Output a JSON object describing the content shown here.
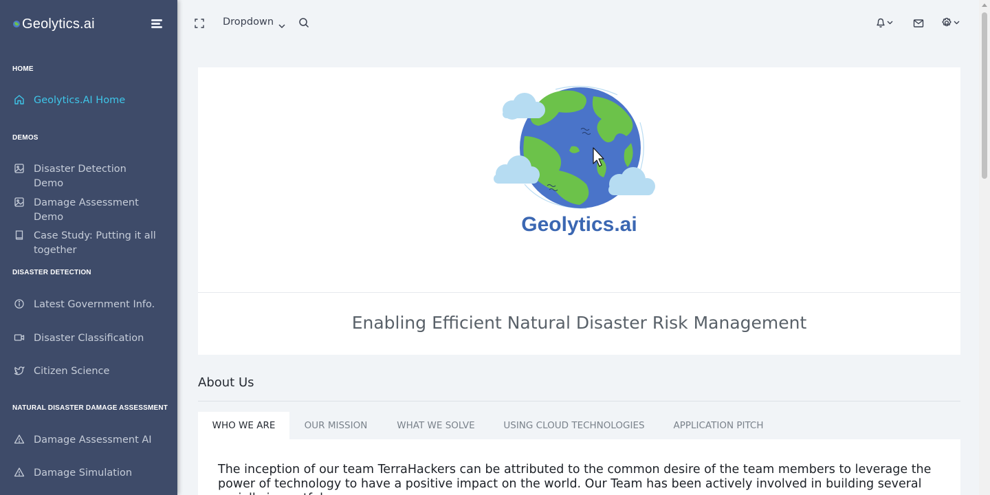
{
  "brand": {
    "name": "Geolytics.ai"
  },
  "sidebar": {
    "sections": [
      {
        "title": "HOME"
      },
      {
        "title": "DEMOS"
      },
      {
        "title": "DISASTER DETECTION"
      },
      {
        "title": "NATURAL DISASTER DAMAGE ASSESSMENT"
      }
    ],
    "items": [
      {
        "label": "Geolytics.AI Home",
        "icon": "home-icon",
        "active": true
      },
      {
        "label": "Disaster Detection Demo",
        "icon": "image-icon"
      },
      {
        "label": "Damage Assessment Demo",
        "icon": "image-icon"
      },
      {
        "label": "Case Study: Putting it all together",
        "icon": "book-icon"
      },
      {
        "label": "Latest Government Info.",
        "icon": "info-icon"
      },
      {
        "label": "Disaster Classification",
        "icon": "video-icon"
      },
      {
        "label": "Citizen Science",
        "icon": "twitter-icon"
      },
      {
        "label": "Damage Assessment AI",
        "icon": "warning-icon"
      },
      {
        "label": "Damage Simulation",
        "icon": "warning-icon"
      }
    ]
  },
  "topbar": {
    "dropdown_label": "Dropdown",
    "icons": [
      "fullscreen-icon",
      "chevron-down-icon",
      "search-icon",
      "bell-icon",
      "mail-icon",
      "gear-icon"
    ]
  },
  "hero": {
    "logo_text": "Geolytics.ai",
    "tagline": "Enabling Efficient Natural Disaster Risk Management"
  },
  "about": {
    "title": "About Us",
    "tabs": [
      {
        "label": "WHO WE ARE",
        "active": true
      },
      {
        "label": "OUR MISSION"
      },
      {
        "label": "WHAT WE SOLVE"
      },
      {
        "label": "USING CLOUD TECHNOLOGIES"
      },
      {
        "label": "APPLICATION PITCH"
      }
    ],
    "content": "The inception of our team TerraHackers can be attributed to the common desire of the team members to leverage the power of technology to have a positive impact on the world. Our Team has been actively involved in building several socially impactful"
  },
  "colors": {
    "sidebar_bg": "#3e4b69",
    "accent": "#3ec6e9",
    "logo_blue": "#3b67b2",
    "land_green": "#6cc24a"
  }
}
